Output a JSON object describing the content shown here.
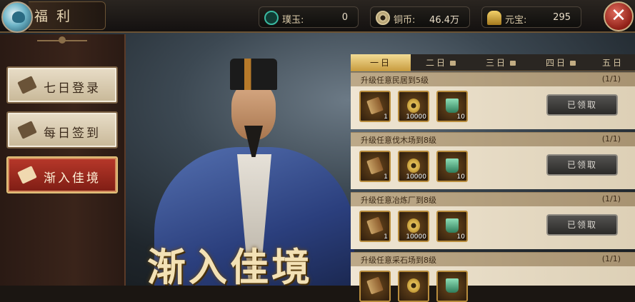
{
  "header": {
    "title": "福利",
    "resources": [
      {
        "label": "璞玉:",
        "value": "0",
        "icon": "jade-icon"
      },
      {
        "label": "铜币:",
        "value": "46.4万",
        "icon": "coin-icon"
      },
      {
        "label": "元宝:",
        "value": "295",
        "icon": "ingot-icon"
      }
    ]
  },
  "sidebar": {
    "items": [
      {
        "label": "七日登录",
        "icon": "login-calendar-icon"
      },
      {
        "label": "每日签到",
        "icon": "feather-icon"
      },
      {
        "label": "渐入佳境",
        "icon": "scroll-icon",
        "active": true
      }
    ]
  },
  "hero": {
    "banner_text": "渐入佳境"
  },
  "tabs": [
    {
      "label": "一日",
      "locked": false,
      "active": true
    },
    {
      "label": "二日",
      "locked": true
    },
    {
      "label": "三日",
      "locked": true
    },
    {
      "label": "四日",
      "locked": true
    },
    {
      "label": "五日",
      "locked": false
    }
  ],
  "tasks": [
    {
      "title": "升级任意民居到5级",
      "count": "(1/1)",
      "button": "已领取",
      "rewards": [
        {
          "icon": "scroll-icon",
          "qty": "1"
        },
        {
          "icon": "coin-icon",
          "qty": "10000"
        },
        {
          "icon": "jade-icon",
          "qty": "10"
        }
      ]
    },
    {
      "title": "升级任意伐木场到8级",
      "count": "(1/1)",
      "button": "已领取",
      "rewards": [
        {
          "icon": "scroll-icon",
          "qty": "1"
        },
        {
          "icon": "coin-icon",
          "qty": "10000"
        },
        {
          "icon": "jade-icon",
          "qty": "10"
        }
      ]
    },
    {
      "title": "升级任意冶炼厂到8级",
      "count": "(1/1)",
      "button": "已领取",
      "rewards": [
        {
          "icon": "scroll-icon",
          "qty": "1"
        },
        {
          "icon": "coin-icon",
          "qty": "10000"
        },
        {
          "icon": "jade-icon",
          "qty": "10"
        }
      ]
    },
    {
      "title": "升级任意采石场到8级",
      "count": "(1/1)",
      "button": "",
      "rewards": [
        {
          "icon": "scroll-icon",
          "qty": ""
        },
        {
          "icon": "coin-icon",
          "qty": ""
        },
        {
          "icon": "jade-icon",
          "qty": ""
        }
      ]
    }
  ]
}
